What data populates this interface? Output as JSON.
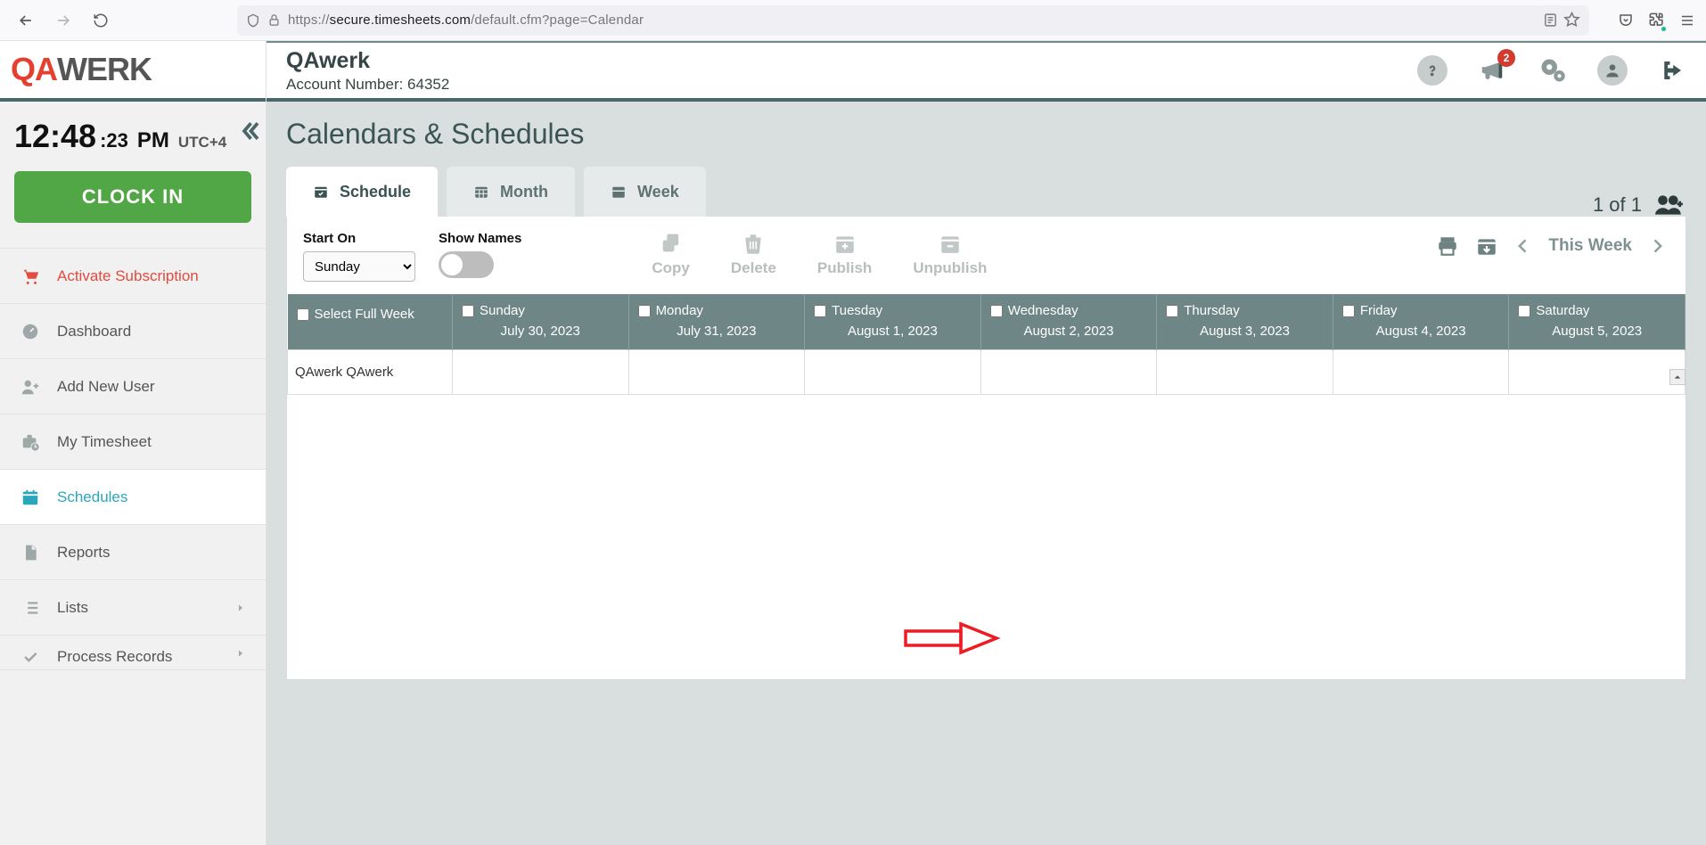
{
  "browser": {
    "url_prefix": "https://",
    "url_host": "secure.timesheets.com",
    "url_path": "/default.cfm?page=Calendar"
  },
  "header": {
    "company": "QAwerk",
    "account_line": "Account Number: 64352",
    "notification_badge": "2"
  },
  "sidebar": {
    "time_main": "12:48",
    "time_sec": ":23",
    "time_pm": "PM",
    "tz": "UTC+4",
    "clockin": "CLOCK IN",
    "items": [
      {
        "label": "Activate Subscription"
      },
      {
        "label": "Dashboard"
      },
      {
        "label": "Add New User"
      },
      {
        "label": "My Timesheet"
      },
      {
        "label": "Schedules"
      },
      {
        "label": "Reports"
      },
      {
        "label": "Lists"
      },
      {
        "label": "Process Records"
      }
    ]
  },
  "page": {
    "title": "Calendars & Schedules",
    "tabs": {
      "schedule": "Schedule",
      "month": "Month",
      "week": "Week"
    },
    "counter": "1 of 1",
    "toolbar": {
      "start_on_label": "Start On",
      "start_on_value": "Sunday",
      "show_names_label": "Show Names",
      "copy": "Copy",
      "delete": "Delete",
      "publish": "Publish",
      "unpublish": "Unpublish",
      "this_week": "This Week"
    },
    "table": {
      "select_full_week": "Select Full Week",
      "days": [
        {
          "name": "Sunday",
          "date": "July 30, 2023"
        },
        {
          "name": "Monday",
          "date": "July 31, 2023"
        },
        {
          "name": "Tuesday",
          "date": "August 1, 2023"
        },
        {
          "name": "Wednesday",
          "date": "August 2, 2023"
        },
        {
          "name": "Thursday",
          "date": "August 3, 2023"
        },
        {
          "name": "Friday",
          "date": "August 4, 2023"
        },
        {
          "name": "Saturday",
          "date": "August 5, 2023"
        }
      ],
      "rows": [
        {
          "name": "QAwerk QAwerk"
        }
      ]
    }
  }
}
